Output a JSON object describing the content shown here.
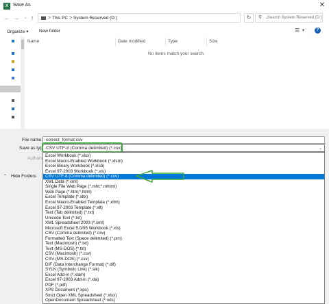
{
  "window": {
    "title": "Save As",
    "app_icon": "X"
  },
  "address": {
    "crumbs": [
      "This PC",
      "System Reserved (D:)"
    ],
    "sep": ">"
  },
  "search": {
    "placeholder": "Search System Reserved (D:)"
  },
  "toolbar": {
    "organize": "Organize ▾",
    "new_folder": "New folder"
  },
  "columns": {
    "name": "Name",
    "date_modified": "Date modified",
    "type": "Type",
    "size": "Size"
  },
  "empty_message": "No items match your search.",
  "form": {
    "file_name_label": "File name:",
    "file_name_value": "correct_format.csv",
    "save_type_label": "Save as type:",
    "save_type_value": "CSV UTF-8 (Comma delimited) (*.csv)",
    "authors_label": "Authors"
  },
  "hide_folders": "Hide Folders",
  "file_types": [
    "Excel Workbook (*.xlsx)",
    "Excel Macro-Enabled Workbook (*.xlsm)",
    "Excel Binary Workbook (*.xlsb)",
    "Excel 97-2003 Workbook (*.xls)",
    "CSV UTF-8 (Comma delimited) (*.csv)",
    "XML Data (*.xml)",
    "Single File Web Page (*.mht;*.mhtml)",
    "Web Page (*.htm;*.html)",
    "Excel Template (*.xltx)",
    "Excel Macro-Enabled Template (*.xltm)",
    "Excel 97-2003 Template (*.xlt)",
    "Text (Tab delimited) (*.txt)",
    "Unicode Text (*.txt)",
    "XML Spreadsheet 2003 (*.xml)",
    "Microsoft Excel 5.0/95 Workbook (*.xls)",
    "CSV (Comma delimited) (*.csv)",
    "Formatted Text (Space delimited) (*.prn)",
    "Text (Macintosh) (*.txt)",
    "Text (MS-DOS) (*.txt)",
    "CSV (Macintosh) (*.csv)",
    "CSV (MS-DOS) (*.csv)",
    "DIF (Data Interchange Format) (*.dif)",
    "SYLK (Symbolic Link) (*.slk)",
    "Excel Add-in (*.xlam)",
    "Excel 97-2003 Add-in (*.xla)",
    "PDF (*.pdf)",
    "XPS Document (*.xps)",
    "Strict Open XML Spreadsheet (*.xlsx)",
    "OpenDocument Spreadsheet (*.ods)"
  ],
  "selected_index": 4,
  "colors": {
    "accent": "#0078d7",
    "highlight_green": "#3fa83f",
    "help_blue": "#1a5fb4"
  }
}
